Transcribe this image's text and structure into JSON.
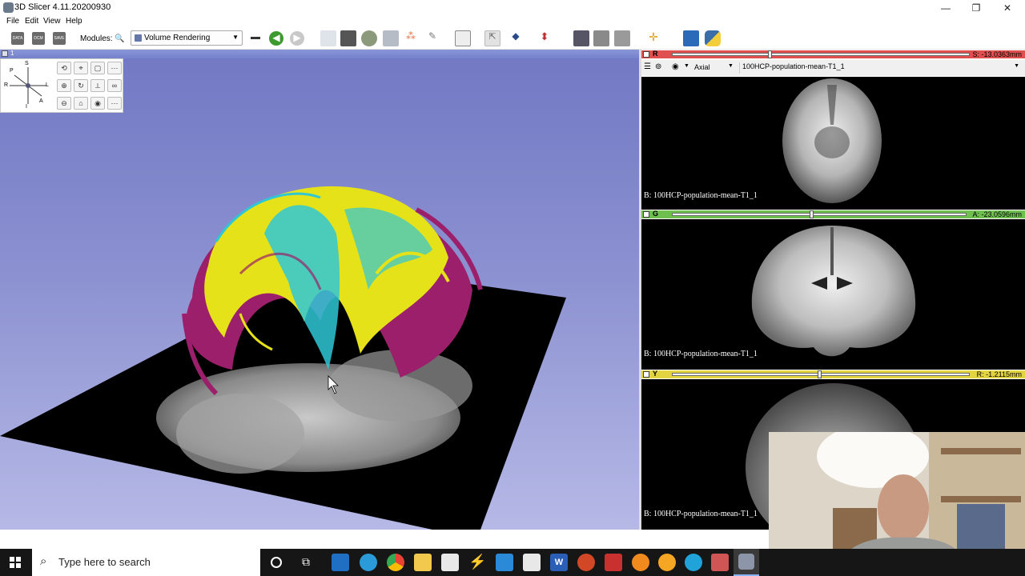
{
  "window": {
    "title": "3D Slicer 4.11.20200930",
    "minimize": "—",
    "restore": "❐",
    "close": "✕"
  },
  "menu": [
    "File",
    "Edit",
    "View",
    "Help"
  ],
  "toolbar": {
    "data_label": "DATA",
    "dcm_label": "DCM",
    "save_label": "SAVE",
    "modules_label": "Modules:",
    "module_selected": "Volume Rendering"
  },
  "view3d": {
    "number": "1",
    "orientation": {
      "S": "S",
      "P": "P",
      "R": "R",
      "L": "L",
      "A": "A",
      "I": "I"
    }
  },
  "slice_red": {
    "letter": "R",
    "offset": "S: -13.0363mm",
    "orientation": "Axial",
    "volume": "100HCP-population-mean-T1_1",
    "label": "B: 100HCP-population-mean-T1_1",
    "color": "#e05050"
  },
  "slice_green": {
    "letter": "G",
    "offset": "A: -23.0596mm",
    "label": "B: 100HCP-population-mean-T1_1",
    "color": "#6fbf4f"
  },
  "slice_yellow": {
    "letter": "Y",
    "offset": "R: -1.2115mm",
    "label": "B: 100HCP-population-mean-T1_1",
    "color": "#e2d340"
  },
  "taskbar": {
    "search_placeholder": "Type here to search"
  },
  "colors": {
    "bg_top": "#7278c3",
    "bg_bottom": "#b6b9e6",
    "fiber_magenta": "#9b1f6a",
    "fiber_yellow": "#e6e21a",
    "fiber_cyan": "#2fc7d6"
  }
}
